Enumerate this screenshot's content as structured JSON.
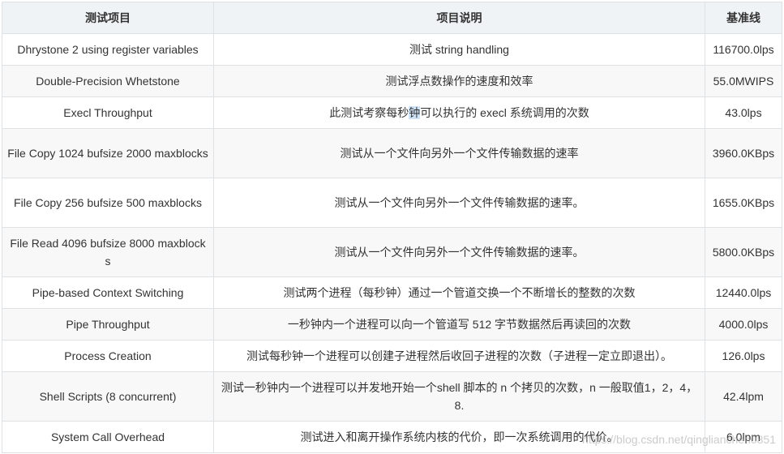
{
  "headers": {
    "name": "测试项目",
    "description": "项目说明",
    "baseline": "基准线"
  },
  "rows": [
    {
      "name": "Dhrystone 2 using register variables",
      "description": "测试 string handling",
      "baseline": "116700.0lps"
    },
    {
      "name": "Double-Precision Whetstone",
      "description": "测试浮点数操作的速度和效率",
      "baseline": "55.0MWIPS"
    },
    {
      "name": "Execl Throughput",
      "description": "此测试考察每秒钟可以执行的 execl 系统调用的次数",
      "baseline": "43.0lps",
      "desc_before": "此测试考察每秒",
      "desc_highlight": "钟",
      "desc_after": "可以执行的 execl 系统调用的次数"
    },
    {
      "name": "File Copy 1024 bufsize 2000 maxblocks",
      "description": "测试从一个文件向另外一个文件传输数据的速率",
      "baseline": "3960.0KBps"
    },
    {
      "name": "File Copy 256 bufsize 500 maxblocks",
      "description": "测试从一个文件向另外一个文件传输数据的速率。",
      "baseline": "1655.0KBps"
    },
    {
      "name": "File Read 4096 bufsize 8000 maxblocks",
      "description": "测试从一个文件向另外一个文件传输数据的速率。",
      "baseline": "5800.0KBps"
    },
    {
      "name": "Pipe-based Context Switching",
      "description": "测试两个进程（每秒钟）通过一个管道交换一个不断增长的整数的次数",
      "baseline": "12440.0lps"
    },
    {
      "name": "Pipe Throughput",
      "description": "一秒钟内一个进程可以向一个管道写 512 字节数据然后再读回的次数",
      "baseline": "4000.0lps"
    },
    {
      "name": "Process Creation",
      "description": "测试每秒钟一个进程可以创建子进程然后收回子进程的次数（子进程一定立即退出）。",
      "baseline": "126.0lps"
    },
    {
      "name": "Shell Scripts (8 concurrent)",
      "description": "测试一秒钟内一个进程可以并发地开始一个shell 脚本的 n 个拷贝的次数，n 一般取值1，2，4，8.",
      "baseline": "42.4lpm"
    },
    {
      "name": "System Call Overhead",
      "description": "测试进入和离开操作系统内核的代价，即一次系统调用的代价。",
      "baseline": "6.0lpm"
    }
  ],
  "watermark": "https://blog.csdn.net/qinglianchen0851"
}
